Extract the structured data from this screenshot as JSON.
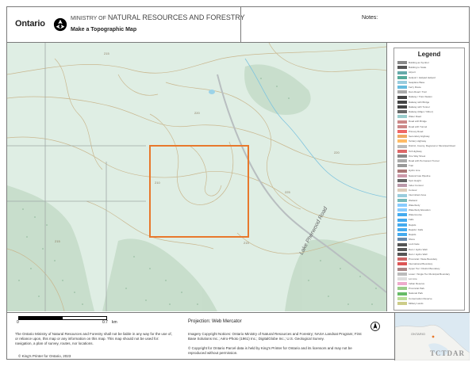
{
  "header": {
    "logo_text": "Ontario",
    "ministry_small": "MINISTRY OF",
    "ministry_name": "NATURAL RESOURCES AND FORESTRY",
    "doc_title": "Make a Topographic Map",
    "notes_label": "Notes:"
  },
  "map": {
    "road_label": "Lake Pherwood Road",
    "contour_labels": [
      "215",
      "220",
      "210",
      "225",
      "215",
      "220",
      "215"
    ],
    "colors": {
      "land": "#dfeee4",
      "contour": "#c9b78f",
      "water": "#9bd3e8",
      "road": "#b8bec0",
      "parcel": "#e8782c"
    }
  },
  "legend": {
    "title": "Legend",
    "items": [
      "Building as Symbol",
      "Building to Scale",
      "Airport",
      "Heliport / Helipad Heliport",
      "Seaplane Base",
      "Ferry Route",
      "Dam Road / Trail",
      "Railway / Train Station",
      "Railway with Bridge",
      "Railway with Tunnel",
      "Railway (Major / Minor)",
      "Water Road",
      "Road with Bridge",
      "Road with Tunnel",
      "Primary Road",
      "Secondary Highway",
      "Tertiary Highway",
      "District, County, Regional or Municipal Road",
      "Toll Highway",
      "One Way Street",
      "Road with Permanent Tunnel",
      "Trail",
      "Hydro Line",
      "Natural Gas Pipeline",
      "Spot Height",
      "Index Contour",
      "Contour",
      "Intermittent Area",
      "Wetland",
      "Waterbody",
      "Waterbody Elevation",
      "Watercourse",
      "Falls",
      "Rapids",
      "Rapids / Falls",
      "Rapids",
      "Shore",
      "Lock Gate",
      "Dam / Hydro Wall",
      "Dam / Hydro Wall",
      "Provincial / State Boundary",
      "International Boundary",
      "Upper Tier / District Boundary",
      "Lower / Single Tier Municipal Boundary",
      "Lot Line",
      "Indian Reserve",
      "Provincial Park",
      "National Park",
      "Conservation Reserve",
      "Military Lands"
    ]
  },
  "footer": {
    "scale_zero": "0",
    "scale_max": "0.7",
    "scale_unit": "km",
    "projection": "Projection: Web Mercator",
    "disclaimer": "The Ontario Ministry of Natural Resources and Forestry shall not be liable in any way for the use of, or reliance upon, this map or any information on this map. This map should not be used for: navigation, a plan of survey, routes, nor locations.",
    "copyright": "© King's Printer for Ontario,  2023",
    "credits": "Imagery Copyright Notices: Ontario Ministry of Natural Resources and Forestry; NASA Landsat Program; First Base Solutions Inc.; Aéro-Photo (1961) Inc.; DigitalGlobe Inc.; U.S. Geological Survey.",
    "credits2": "© Copyright for Ontario Parcel data is held by King's Printer for Ontario and its licensors and may not be reproduced without permission.",
    "inset_label": "ONTARIO",
    "watermark": "TCTDAR"
  }
}
